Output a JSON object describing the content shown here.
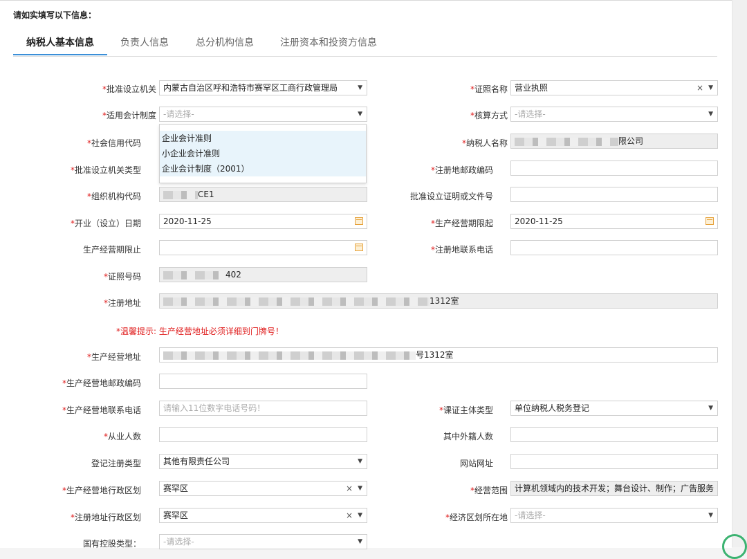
{
  "intro": "请如实填写以下信息：",
  "tabs": [
    "纳税人基本信息",
    "负责人信息",
    "总分机构信息",
    "注册资本和投资方信息"
  ],
  "warning": "*温馨提示: 生产经营地址必须详细到门牌号！",
  "placeholders": {
    "select": "-请选择-",
    "phone": "请输入11位数字电话号码！"
  },
  "fields": {
    "approval_authority": {
      "label": "批准设立机关",
      "value": "内蒙古自治区呼和浩特市赛罕区工商行政管理局"
    },
    "license_name": {
      "label": "证照名称",
      "value": "营业执照"
    },
    "accounting_system": {
      "label": "适用会计制度"
    },
    "accounting_method": {
      "label": "核算方式"
    },
    "credit_code": {
      "label": "社会信用代码"
    },
    "taxpayer_name": {
      "label": "纳税人名称",
      "value": "限公司"
    },
    "authority_type": {
      "label": "批准设立机关类型"
    },
    "reg_postcode": {
      "label": "注册地邮政编码"
    },
    "org_code": {
      "label": "组织机构代码",
      "value": "CE1"
    },
    "approval_doc": {
      "label": "批准设立证明或文件号"
    },
    "open_date": {
      "label": "开业（设立）日期",
      "value": "2020-11-25"
    },
    "op_start": {
      "label": "生产经营期限起",
      "value": "2020-11-25"
    },
    "op_end": {
      "label": "生产经营期限止"
    },
    "reg_phone": {
      "label": "注册地联系电话"
    },
    "license_no": {
      "label": "证照号码",
      "value": "402"
    },
    "reg_address": {
      "label": "注册地址",
      "value": "1312室"
    },
    "op_address": {
      "label": "生产经营地址",
      "value": "号1312室"
    },
    "op_postcode": {
      "label": "生产经营地邮政编码"
    },
    "op_phone": {
      "label": "生产经营地联系电话"
    },
    "subject_type": {
      "label": "课证主体类型",
      "value": "单位纳税人税务登记"
    },
    "employees": {
      "label": "从业人数"
    },
    "foreign_employees": {
      "label": "其中外籍人数"
    },
    "reg_type": {
      "label": "登记注册类型",
      "value": "其他有限责任公司"
    },
    "website": {
      "label": "网站网址"
    },
    "op_division": {
      "label": "生产经营地行政区划",
      "value": "赛罕区"
    },
    "scope": {
      "label": "经营范围",
      "value": "计算机领域内的技术开发；舞台设计、制作；广告服务"
    },
    "reg_division": {
      "label": "注册地址行政区划",
      "value": "赛罕区"
    },
    "econ_zone": {
      "label": "经济区划所在地"
    },
    "state_holding": {
      "label": "国有控股类型："
    }
  },
  "accounting_options": [
    "企业会计准则",
    "小企业会计准则",
    "企业会计制度（2001）"
  ]
}
